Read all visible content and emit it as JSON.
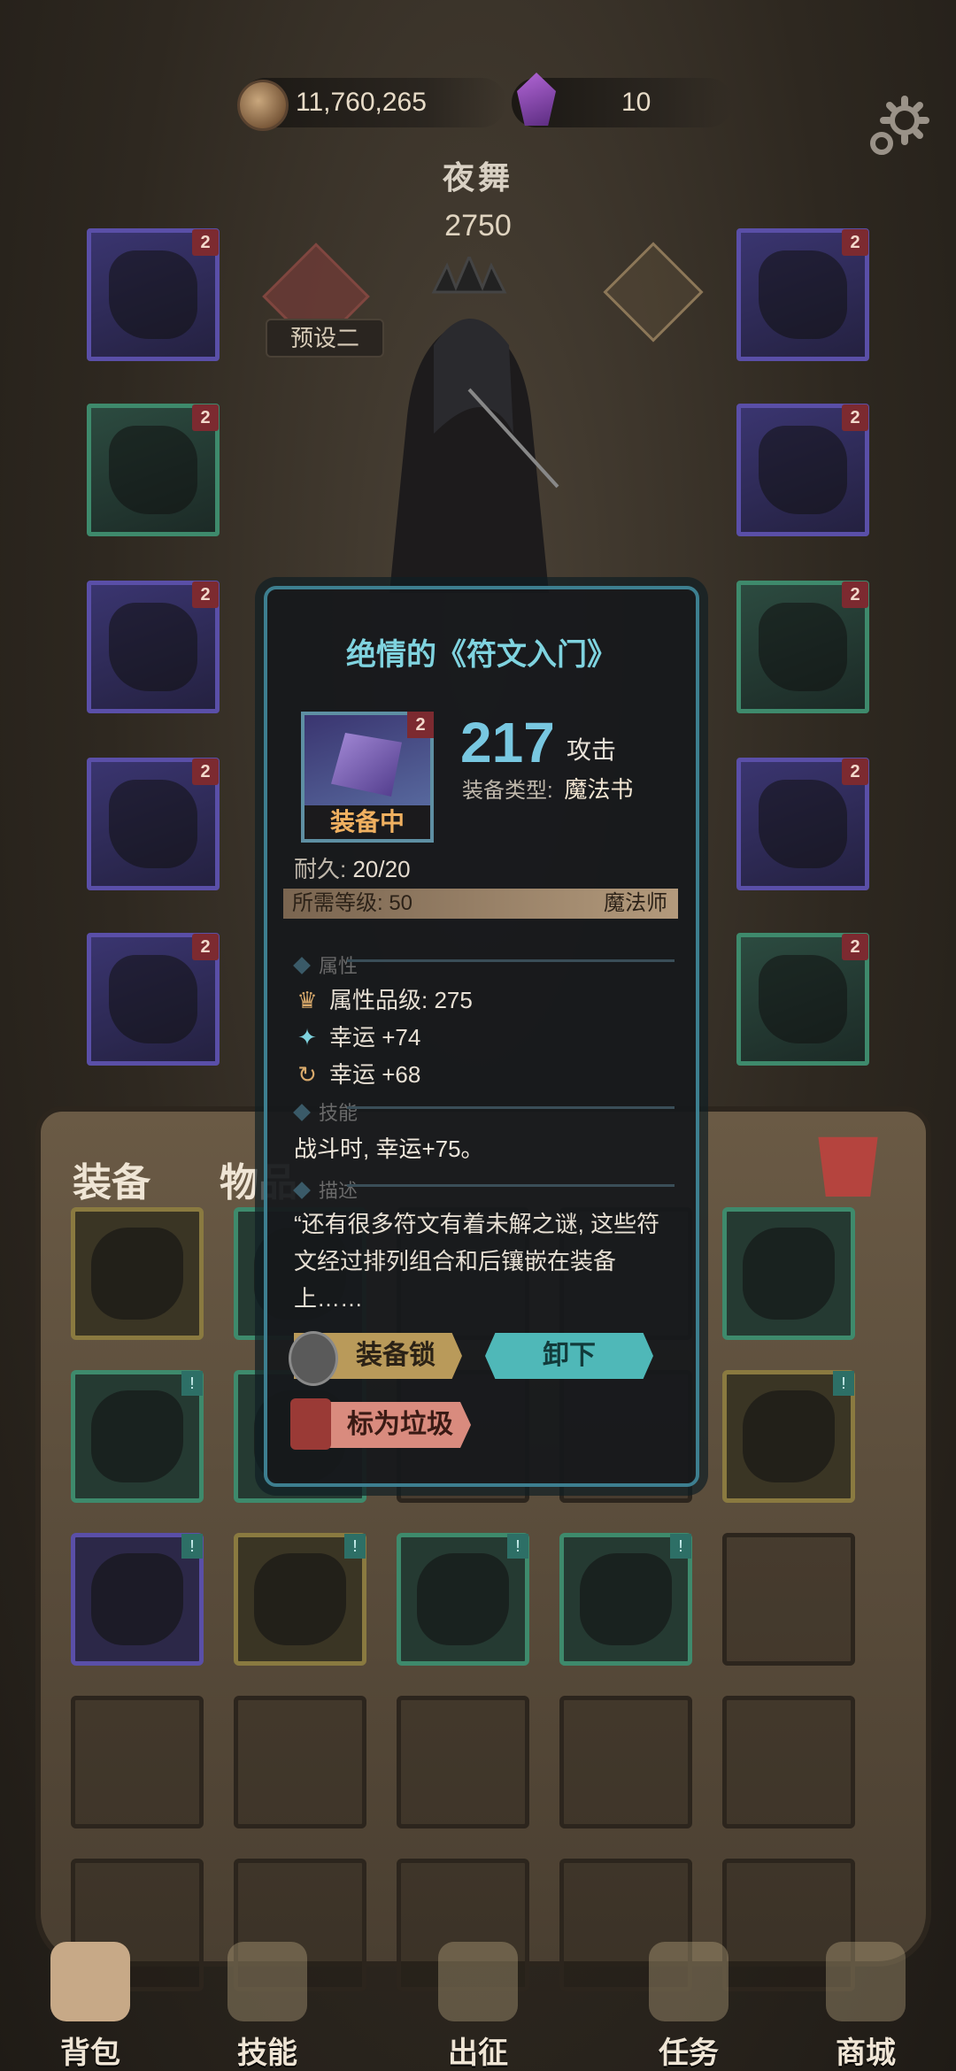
{
  "topbar": {
    "coins": "11,760,265",
    "gems": "10",
    "coin_icon": "coin-icon",
    "gem_icon": "purple-gem-icon",
    "settings_icon": "gear-icon"
  },
  "character": {
    "name": "夜舞",
    "power": "2750",
    "preset_label": "预设二"
  },
  "equipment_slots": {
    "left": [
      {
        "level": "2",
        "rarity": "rare"
      },
      {
        "level": "2",
        "rarity": "uncommon"
      },
      {
        "level": "2",
        "rarity": "rare"
      },
      {
        "level": "2",
        "rarity": "rare"
      },
      {
        "level": "2",
        "rarity": "rare"
      }
    ],
    "right": [
      {
        "level": "2",
        "rarity": "rare"
      },
      {
        "level": "2",
        "rarity": "rare"
      },
      {
        "level": "2",
        "rarity": "uncommon"
      },
      {
        "level": "2",
        "rarity": "rare"
      },
      {
        "level": "2",
        "rarity": "uncommon"
      }
    ]
  },
  "tabs": {
    "equip": "装备",
    "items": "物品"
  },
  "popup": {
    "title": "绝情的《符文入门》",
    "icon_level": "2",
    "equipped_label": "装备中",
    "stat_value": "217",
    "stat_name": "攻击",
    "equip_type_label": "装备类型:",
    "equip_type_value": "魔法书",
    "durability_label": "耐久:",
    "durability_value": "20/20",
    "required_level_label": "所需等级: 50",
    "required_class": "魔法师",
    "section_attributes": "属性",
    "attributes": [
      {
        "icon": "crown-icon",
        "text": "属性品级: 275"
      },
      {
        "icon": "sparkle-icon",
        "text": "幸运 +74"
      },
      {
        "icon": "cycle-icon",
        "text": "幸运 +68"
      }
    ],
    "section_skill": "技能",
    "skill_text": "战斗时, 幸运+75。",
    "section_desc": "描述",
    "description": "“还有很多符文有着未解之谜, 这些符文经过排列组合和后镶嵌在装备上……",
    "btn_lock": "装备锁",
    "btn_unequip": "卸下",
    "btn_trash": "标为垃圾"
  },
  "bag": {
    "cells": [
      {
        "rarity": "gold",
        "tag": ""
      },
      {
        "rarity": "unc",
        "tag": ""
      },
      {
        "rarity": "",
        "tag": ""
      },
      {
        "rarity": "",
        "tag": ""
      },
      {
        "rarity": "unc",
        "tag": ""
      },
      {
        "rarity": "unc",
        "tag": "!"
      },
      {
        "rarity": "unc",
        "tag": ""
      },
      {
        "rarity": "",
        "tag": ""
      },
      {
        "rarity": "",
        "tag": ""
      },
      {
        "rarity": "gold",
        "tag": "!"
      },
      {
        "rarity": "rare",
        "tag": "!"
      },
      {
        "rarity": "gold",
        "tag": "!"
      },
      {
        "rarity": "unc",
        "tag": "!"
      },
      {
        "rarity": "unc",
        "tag": "!"
      },
      {
        "rarity": "",
        "tag": ""
      },
      {
        "rarity": "",
        "tag": ""
      },
      {
        "rarity": "",
        "tag": ""
      },
      {
        "rarity": "",
        "tag": ""
      },
      {
        "rarity": "",
        "tag": ""
      },
      {
        "rarity": "",
        "tag": ""
      },
      {
        "rarity": "",
        "tag": ""
      },
      {
        "rarity": "",
        "tag": ""
      },
      {
        "rarity": "",
        "tag": ""
      },
      {
        "rarity": "",
        "tag": ""
      },
      {
        "rarity": "",
        "tag": ""
      }
    ]
  },
  "nav": [
    {
      "label": "背包",
      "icon": "backpack-icon",
      "active": true
    },
    {
      "label": "技能",
      "icon": "skill-book-icon",
      "active": false
    },
    {
      "label": "出征",
      "icon": "sword-icon",
      "active": false
    },
    {
      "label": "任务",
      "icon": "quest-scroll-icon",
      "active": false
    },
    {
      "label": "商城",
      "icon": "shop-icon",
      "active": false
    }
  ]
}
